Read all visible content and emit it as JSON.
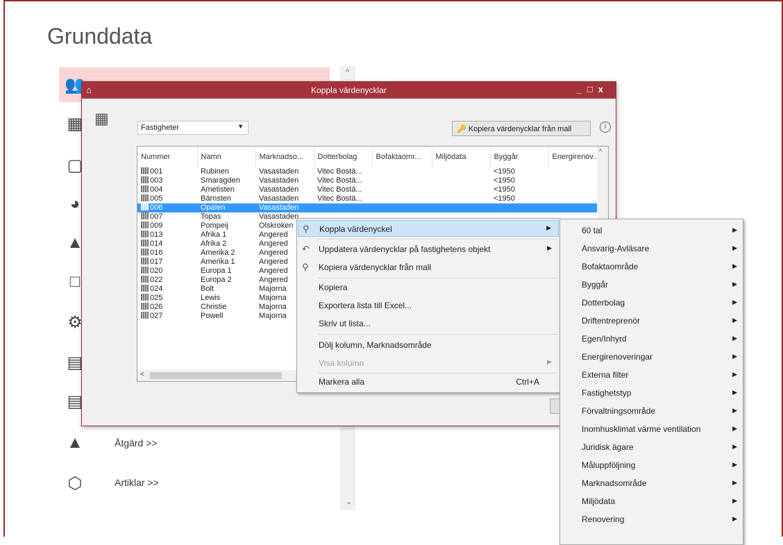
{
  "page": {
    "title": "Grunddata"
  },
  "bg_list": [
    {
      "icon": "people-icon",
      "label": ""
    },
    {
      "icon": "building-icon",
      "label": ""
    },
    {
      "icon": "panel-icon",
      "label": ""
    },
    {
      "icon": "helmet-icon",
      "label": ""
    },
    {
      "icon": "weight-icon",
      "label": ""
    },
    {
      "icon": "floorplan-icon",
      "label": ""
    },
    {
      "icon": "gears-icon",
      "label": ""
    },
    {
      "icon": "calculator-icon",
      "label": ""
    },
    {
      "icon": "list-icon",
      "label": ""
    },
    {
      "icon": "brush-icon",
      "label": "Åtgärd >>"
    },
    {
      "icon": "cube-icon",
      "label": "Artiklar >>"
    }
  ],
  "dialog": {
    "title": "Koppla värdenycklar",
    "combo_value": "Fastigheter",
    "copy_button": "Kopiera värdenycklar från mall",
    "info": "i",
    "columns": [
      "Nummer",
      "Namn",
      "Marknadso...",
      "Dotterbolag",
      "Bofaktaomr...",
      "Miljödata",
      "Byggår",
      "Energirenov..."
    ],
    "rows": [
      [
        "001",
        "Rubinen",
        "Vasastaden",
        "Vitec Bostä...",
        "",
        "",
        "<1950",
        ""
      ],
      [
        "003",
        "Smaragden",
        "Vasastaden",
        "Vitec Bostä...",
        "",
        "",
        "<1950",
        ""
      ],
      [
        "004",
        "Ametisten",
        "Vasastaden",
        "Vitec Bostä...",
        "",
        "",
        "<1950",
        ""
      ],
      [
        "005",
        "Bärnsten",
        "Vasastaden",
        "Vitec Bostä...",
        "",
        "",
        "<1950",
        ""
      ],
      [
        "006",
        "Opalen",
        "Vasastaden",
        "",
        "",
        "",
        "",
        ""
      ],
      [
        "007",
        "Topas",
        "Vasastaden",
        "",
        "",
        "",
        "",
        ""
      ],
      [
        "009",
        "Pompeij",
        "Olskroken",
        "",
        "",
        "",
        "",
        ""
      ],
      [
        "013",
        "Afrika 1",
        "Angered",
        "",
        "",
        "",
        "",
        ""
      ],
      [
        "014",
        "Afrika 2",
        "Angered",
        "",
        "",
        "",
        "",
        ""
      ],
      [
        "016",
        "Amerika 2",
        "Angered",
        "",
        "",
        "",
        "",
        ""
      ],
      [
        "017",
        "Amerika 1",
        "Angered",
        "",
        "",
        "",
        "",
        ""
      ],
      [
        "020",
        "Europa 1",
        "Angered",
        "",
        "",
        "",
        "",
        ""
      ],
      [
        "022",
        "Europa 2",
        "Angered",
        "",
        "",
        "",
        "",
        ""
      ],
      [
        "024",
        "Bolt",
        "Majorna",
        "",
        "",
        "",
        "",
        ""
      ],
      [
        "025",
        "Lewis",
        "Majorna",
        "",
        "",
        "",
        "",
        ""
      ],
      [
        "026",
        "Christie",
        "Majorna",
        "",
        "",
        "",
        "",
        ""
      ],
      [
        "027",
        "Powell",
        "Majorna",
        "",
        "",
        "",
        "",
        ""
      ]
    ],
    "selected_row": 4
  },
  "context_menu": {
    "items": [
      {
        "label": "Koppla värdenyckel",
        "icon": "key-icon",
        "submenu": true,
        "highlighted": true
      },
      {
        "label": "Uppdatera värdenycklar på fastighetens objekt",
        "icon": "refresh-icon",
        "submenu": true
      },
      {
        "label": "Kopiera värdenycklar från mall",
        "icon": "key-copy-icon"
      },
      {
        "label": "Kopiera"
      },
      {
        "label": "Exportera lista till Excel..."
      },
      {
        "label": "Skriv ut lista..."
      },
      {
        "label": "Dölj kolumn, Marknadsområde"
      },
      {
        "label": "Visa kolumn",
        "submenu": true,
        "disabled": true
      },
      {
        "label": "Markera alla",
        "shortcut": "Ctrl+A"
      }
    ]
  },
  "submenu": {
    "items": [
      "60 tal",
      "Ansvarig-Avläsare",
      "Bofaktaområde",
      "Byggår",
      "Dotterbolag",
      "Driftentreprenör",
      "Egen/Inhyrd",
      "Energirenoveringar",
      "Externa filter",
      "Fastighetstyp",
      "Förvaltningsområde",
      "Inomhusklimat värme ventilation",
      "Juridisk ägare",
      "Måluppföljning",
      "Marknadsområde",
      "Miljödata",
      "Renovering"
    ]
  },
  "colors": {
    "titlebar": "#a4333b",
    "selection": "#3399ff",
    "menu_highlight": "#cde4f7"
  }
}
